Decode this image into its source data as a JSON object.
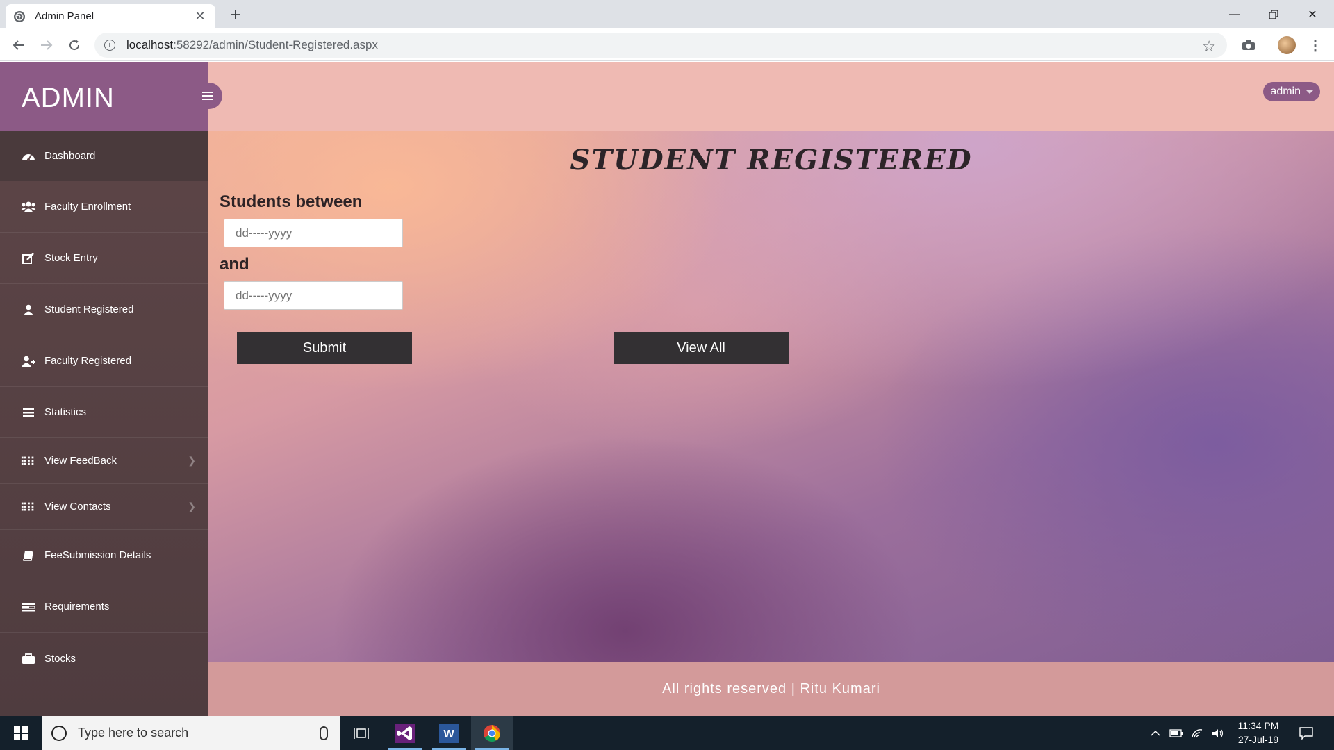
{
  "browser": {
    "tab_title": "Admin Panel",
    "url_host": "localhost",
    "url_path": ":58292/admin/Student-Registered.aspx"
  },
  "sidebar": {
    "brand": "ADMIN",
    "items": [
      {
        "label": "Dashboard",
        "icon": "dashboard-icon"
      },
      {
        "label": "Faculty Enrollment",
        "icon": "users-icon"
      },
      {
        "label": "Stock Entry",
        "icon": "edit-icon"
      },
      {
        "label": "Student Registered",
        "icon": "user-icon"
      },
      {
        "label": "Faculty Registered",
        "icon": "user-plus-icon"
      },
      {
        "label": "Statistics",
        "icon": "list-icon"
      },
      {
        "label": "View FeedBack",
        "icon": "grid-icon"
      },
      {
        "label": "View Contacts",
        "icon": "grid-icon"
      },
      {
        "label": "FeeSubmission Details",
        "icon": "book-icon"
      },
      {
        "label": "Requirements",
        "icon": "tasks-icon"
      },
      {
        "label": "Stocks",
        "icon": "briefcase-icon"
      }
    ]
  },
  "header": {
    "user_label": "admin"
  },
  "content": {
    "title": "STUDENT REGISTERED",
    "label_between": "Students between",
    "label_and": "and",
    "from_placeholder": "dd-----yyyy",
    "to_placeholder": "dd-----yyyy",
    "submit_label": "Submit",
    "view_all_label": "View All"
  },
  "footer": {
    "text": "All rights reserved | Ritu Kumari"
  },
  "taskbar": {
    "search_placeholder": "Type here to search",
    "time": "11:34 PM",
    "date": "27-Jul-19"
  }
}
